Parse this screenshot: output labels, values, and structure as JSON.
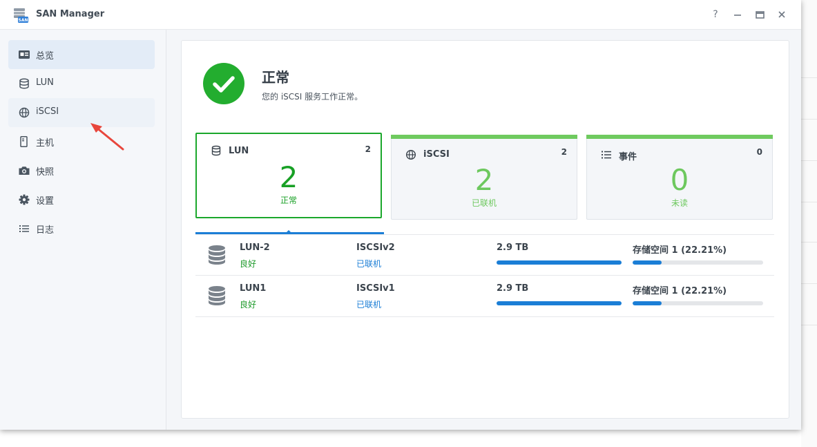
{
  "window": {
    "title": "SAN Manager",
    "app_icon_badge": "SAN"
  },
  "sidebar": {
    "items": [
      {
        "label": "总览",
        "icon": "overview-icon",
        "state": "active"
      },
      {
        "label": "LUN",
        "icon": "database-icon",
        "state": "normal"
      },
      {
        "label": "iSCSI",
        "icon": "globe-icon",
        "state": "hover"
      },
      {
        "label": "主机",
        "icon": "host-icon",
        "state": "normal"
      },
      {
        "label": "快照",
        "icon": "camera-icon",
        "state": "normal"
      },
      {
        "label": "设置",
        "icon": "gear-icon",
        "state": "normal"
      },
      {
        "label": "日志",
        "icon": "list-icon",
        "state": "normal"
      }
    ]
  },
  "status": {
    "title": "正常",
    "description": "您的 iSCSI 服务工作正常。",
    "color": "#23ad2f"
  },
  "cards": [
    {
      "title": "LUN",
      "count": "2",
      "big": "2",
      "sub": "正常"
    },
    {
      "title": "iSCSI",
      "count": "2",
      "big": "2",
      "sub": "已联机"
    },
    {
      "title": "事件",
      "count": "0",
      "big": "0",
      "sub": "未读"
    }
  ],
  "lun_rows": [
    {
      "name": "LUN-2",
      "health": "良好",
      "target": "ISCSIv2",
      "target_status": "已联机",
      "size": "2.9 TB",
      "pool": "存储空间 1 (22.21%)",
      "pool_percent": 22.21
    },
    {
      "name": "LUN1",
      "health": "良好",
      "target": "ISCSIv1",
      "target_status": "已联机",
      "size": "2.9 TB",
      "pool": "存储空间 1 (22.21%)",
      "pool_percent": 22.21
    }
  ],
  "colors": {
    "accent": "#1b7ed6",
    "success": "#1aa72b",
    "success_light": "#6dc85e",
    "annotation_arrow": "#e8463c"
  }
}
